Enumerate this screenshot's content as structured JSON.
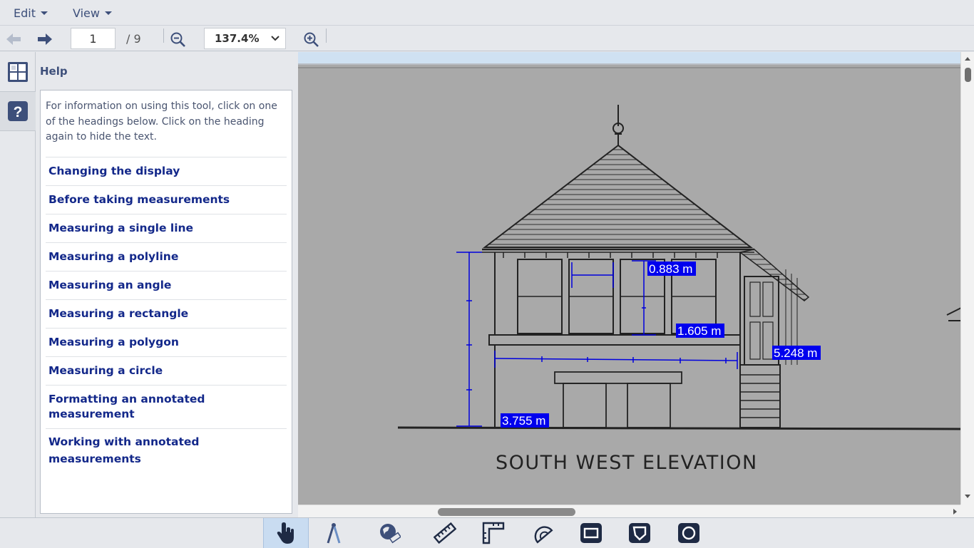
{
  "menubar": {
    "edit_label": "Edit",
    "view_label": "View"
  },
  "toolbar": {
    "page_value": "1",
    "page_total": "/ 9",
    "zoom_value": "137.4%"
  },
  "help": {
    "title": "Help",
    "intro": "For information on using this tool, click on one of the headings below. Click on the heading again to hide the text.",
    "links": [
      "Changing the display",
      "Before taking measurements",
      "Measuring a single line",
      "Measuring a polyline",
      "Measuring an angle",
      "Measuring a rectangle",
      "Measuring a polygon",
      "Measuring a circle",
      "Formatting an annotated measurement",
      "Working with annotated measurements"
    ]
  },
  "drawing": {
    "caption": "SOUTH WEST ELEVATION",
    "measurements": [
      "0.883 m",
      "1.605 m",
      "5.248 m",
      "3.755 m"
    ],
    "measure_color": "#0000dd",
    "label_bg": "#0000ee"
  },
  "tools": [
    {
      "name": "pan-hand-icon",
      "active": true
    },
    {
      "name": "compass-icon",
      "active": false
    },
    {
      "name": "calibrate-icon",
      "active": false
    },
    {
      "name": "ruler-icon",
      "active": false
    },
    {
      "name": "polyline-ruler-icon",
      "active": false
    },
    {
      "name": "protractor-icon",
      "active": false
    },
    {
      "name": "rectangle-icon",
      "active": false
    },
    {
      "name": "polygon-icon",
      "active": false
    },
    {
      "name": "circle-icon",
      "active": false
    }
  ],
  "colors": {
    "accent": "#3d4f7a",
    "link": "#13288a",
    "active_tool": "#c9dcf1"
  }
}
